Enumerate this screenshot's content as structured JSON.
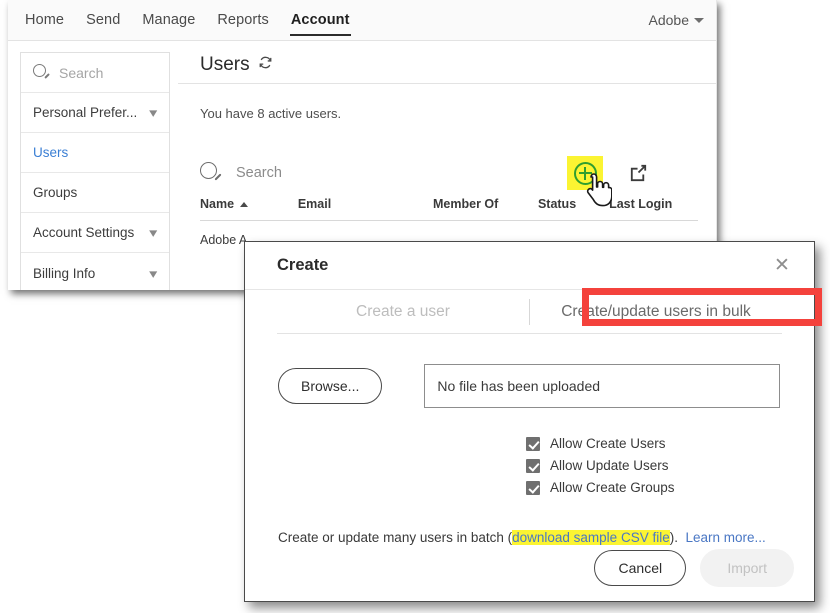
{
  "topnav": {
    "links": [
      {
        "label": "Home",
        "active": false
      },
      {
        "label": "Send",
        "active": false
      },
      {
        "label": "Manage",
        "active": false
      },
      {
        "label": "Reports",
        "active": false
      },
      {
        "label": "Account",
        "active": true
      }
    ],
    "account_menu_label": "Adobe"
  },
  "sidebar": {
    "search_placeholder": "Search",
    "items": [
      {
        "label": "Personal Prefer...",
        "chevron": "chevron-down",
        "active": false
      },
      {
        "label": "Users",
        "chevron": "",
        "active": true
      },
      {
        "label": "Groups",
        "chevron": "",
        "active": false
      },
      {
        "label": "Account Settings",
        "chevron": "chevron-down",
        "active": false
      },
      {
        "label": "Billing Info",
        "chevron": "chevron-down",
        "active": false
      }
    ]
  },
  "main": {
    "page_title": "Users",
    "refresh_icon": "refresh-icon",
    "status_text": "You have 8 active users.",
    "table_search_placeholder": "Search",
    "toolbar_icons": [
      {
        "name": "add-user-icon",
        "highlighted": true,
        "color": "#2f9e2f"
      },
      {
        "name": "export-icon",
        "highlighted": false
      },
      {
        "name": "hamburger-menu-icon",
        "highlighted": false
      }
    ],
    "table": {
      "columns": [
        "Name",
        "Email",
        "Member Of",
        "Status",
        "Last Login"
      ],
      "sort_column": "Name",
      "sort_direction": "ascending",
      "rows": [
        {
          "name": "Adobe A",
          "email": "",
          "member_of": "",
          "status": "",
          "last_login": ""
        }
      ]
    }
  },
  "modal": {
    "title": "Create",
    "close_icon": "close-icon",
    "tabs": [
      {
        "label": "Create a user",
        "selected": false
      },
      {
        "label": "Create/update users in bulk",
        "selected": true,
        "annotated": true
      }
    ],
    "browse_button": "Browse...",
    "file_field_value": "No file has been uploaded",
    "checkboxes": [
      {
        "label": "Allow Create Users",
        "checked": true
      },
      {
        "label": "Allow Update Users",
        "checked": true
      },
      {
        "label": "Allow Create Groups",
        "checked": true
      }
    ],
    "batch_text_before": "Create or update many users in batch (",
    "batch_link_highlighted": "download sample CSV file",
    "batch_text_after": ").",
    "learn_more": "Learn more...",
    "cancel_button": "Cancel",
    "import_button": "Import"
  },
  "annotations": {
    "highlight_yellow": "#fbf432",
    "annotation_red": "#f4423c",
    "link_blue": "#4a77c4",
    "accent_green": "#2f9e2f"
  }
}
